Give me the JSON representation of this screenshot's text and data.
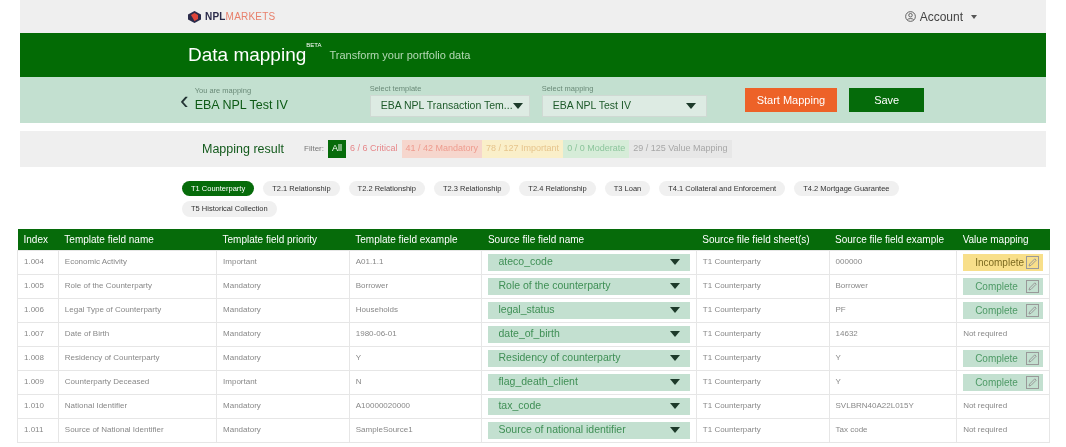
{
  "topbar": {
    "logo_bold": "NPL",
    "logo_light": "MARKETS",
    "account": "Account"
  },
  "header": {
    "title": "Data mapping",
    "badge": "BETA",
    "subtitle": "Transform your portfolio data"
  },
  "mapping_bar": {
    "back": "‹",
    "mapping_label": "You are mapping",
    "mapping_name": "EBA NPL Test IV",
    "template_label": "Select template",
    "template_value": "EBA NPL Transaction Tem...",
    "mapping_select_label": "Select mapping",
    "mapping_value": "EBA NPL Test IV",
    "start_button": "Start Mapping",
    "save_button": "Save"
  },
  "result": {
    "title": "Mapping result",
    "filter_label": "Filter:",
    "filters": [
      {
        "label": "All",
        "kind": "all",
        "selected": true
      },
      {
        "label": "6 / 6 Critical",
        "kind": "critical",
        "selected": false
      },
      {
        "label": "41 / 42 Mandatory",
        "kind": "mandatory",
        "selected": false
      },
      {
        "label": "78 / 127 Important",
        "kind": "important",
        "selected": false
      },
      {
        "label": "0 / 0 Moderate",
        "kind": "moderate",
        "selected": false
      },
      {
        "label": "29 / 125 Value Mapping",
        "kind": "value",
        "selected": false
      }
    ]
  },
  "tabs": [
    {
      "label": "T1 Counterparty",
      "selected": true
    },
    {
      "label": "T2.1 Relationship",
      "selected": false
    },
    {
      "label": "T2.2 Relationship",
      "selected": false
    },
    {
      "label": "T2.3 Relationship",
      "selected": false
    },
    {
      "label": "T2.4 Relationship",
      "selected": false
    },
    {
      "label": "T3 Loan",
      "selected": false
    },
    {
      "label": "T4.1 Collateral and Enforcement",
      "selected": false
    },
    {
      "label": "T4.2 Mortgage Guarantee",
      "selected": false
    },
    {
      "label": "T5 Historical Collection",
      "selected": false
    }
  ],
  "table": {
    "columns": [
      "Index",
      "Template field name",
      "Template field priority",
      "Template field example",
      "Source file field name",
      "Source file field sheet(s)",
      "Source file field example",
      "Value mapping"
    ],
    "rows": [
      {
        "index": "1.004",
        "name": "Economic Activity",
        "priority": "Important",
        "example": "A01.1.1",
        "source_field": "ateco_code",
        "sheet": "T1 Counterparty",
        "source_example": "000000",
        "value_mapping": {
          "label": "Incomplete",
          "kind": "incomplete"
        }
      },
      {
        "index": "1.005",
        "name": "Role of the Counterparty",
        "priority": "Mandatory",
        "example": "Borrower",
        "source_field": "Role of the counterparty",
        "sheet": "T1 Counterparty",
        "source_example": "Borrower",
        "value_mapping": {
          "label": "Complete",
          "kind": "complete"
        }
      },
      {
        "index": "1.006",
        "name": "Legal Type of Counterparty",
        "priority": "Mandatory",
        "example": "Households",
        "source_field": "legal_status",
        "sheet": "T1 Counterparty",
        "source_example": "PF",
        "value_mapping": {
          "label": "Complete",
          "kind": "complete"
        }
      },
      {
        "index": "1.007",
        "name": "Date of Birth",
        "priority": "Mandatory",
        "example": "1980-06-01",
        "source_field": "date_of_birth",
        "sheet": "T1 Counterparty",
        "source_example": "14632",
        "value_mapping": {
          "label": "Not required",
          "kind": "not_required"
        }
      },
      {
        "index": "1.008",
        "name": "Residency of Counterparty",
        "priority": "Mandatory",
        "example": "Y",
        "source_field": "Residency of counterparty",
        "sheet": "T1 Counterparty",
        "source_example": "Y",
        "value_mapping": {
          "label": "Complete",
          "kind": "complete"
        }
      },
      {
        "index": "1.009",
        "name": "Counterparty Deceased",
        "priority": "Important",
        "example": "N",
        "source_field": "flag_death_client",
        "sheet": "T1 Counterparty",
        "source_example": "Y",
        "value_mapping": {
          "label": "Complete",
          "kind": "complete"
        }
      },
      {
        "index": "1.010",
        "name": "National Identifier",
        "priority": "Mandatory",
        "example": "A10000020000",
        "source_field": "tax_code",
        "sheet": "T1 Counterparty",
        "source_example": "SVLBRN40A22L015Y",
        "value_mapping": {
          "label": "Not required",
          "kind": "not_required"
        }
      },
      {
        "index": "1.011",
        "name": "Source of National Identifier",
        "priority": "Mandatory",
        "example": "SampleSource1",
        "source_field": "Source of national identifier",
        "sheet": "T1 Counterparty",
        "source_example": "Tax code",
        "value_mapping": {
          "label": "Not required",
          "kind": "not_required"
        }
      }
    ]
  }
}
